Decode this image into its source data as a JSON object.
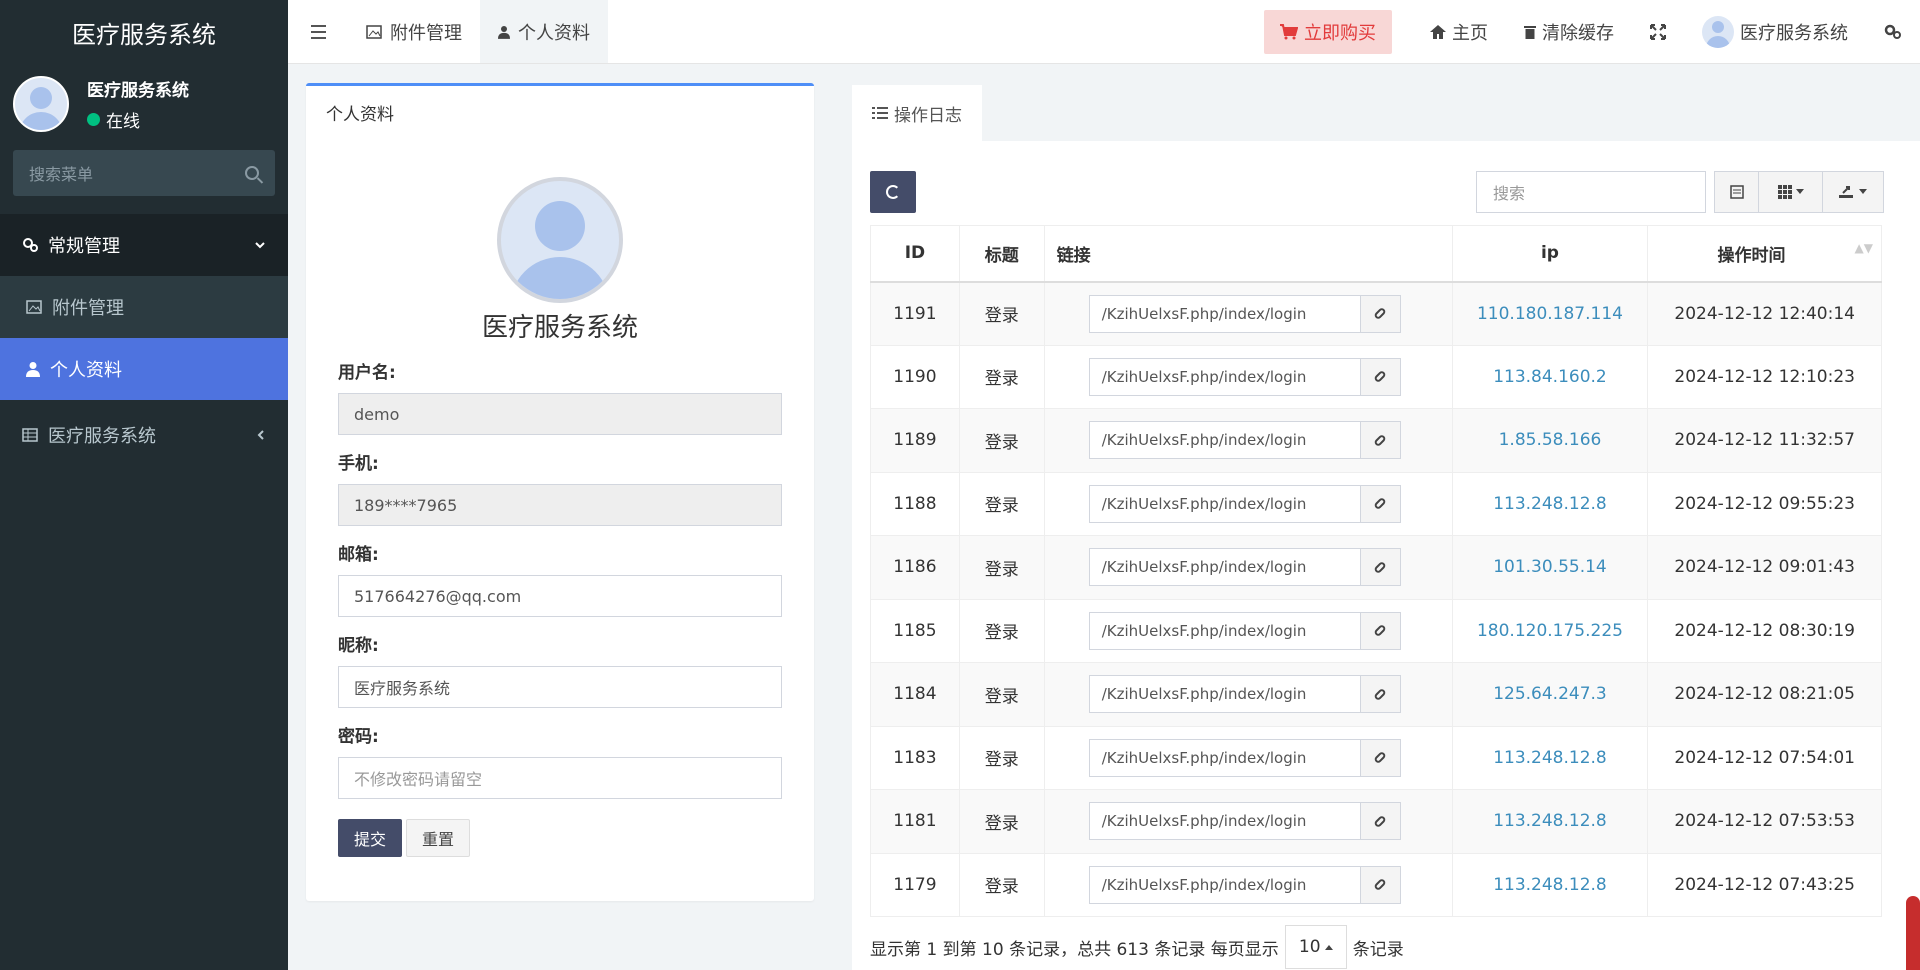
{
  "sidebar": {
    "brand": "医疗服务系统",
    "user": {
      "name": "医疗服务系统",
      "status": "在线"
    },
    "search_placeholder": "搜索菜单",
    "group": {
      "label": "常规管理"
    },
    "items": [
      {
        "label": "附件管理",
        "icon": "image-icon"
      },
      {
        "label": "个人资料",
        "icon": "user-icon",
        "active": true
      }
    ],
    "top_item": {
      "label": "医疗服务系统",
      "icon": "table-icon"
    }
  },
  "topbar": {
    "tabs": [
      {
        "label": "附件管理",
        "icon": "image-icon"
      },
      {
        "label": "个人资料",
        "icon": "user-icon",
        "active": true
      }
    ],
    "buy_label": "立即购买",
    "home_label": "主页",
    "clear_cache_label": "清除缓存",
    "user_label": "医疗服务系统"
  },
  "profile": {
    "card_title": "个人资料",
    "name": "医疗服务系统",
    "fields": {
      "username": {
        "label": "用户名:",
        "value": "demo"
      },
      "mobile": {
        "label": "手机:",
        "value": "189****7965"
      },
      "email": {
        "label": "邮箱:",
        "value": "517664276@qq.com"
      },
      "nickname": {
        "label": "昵称:",
        "value": "医疗服务系统"
      },
      "password": {
        "label": "密码:",
        "placeholder": "不修改密码请留空"
      }
    },
    "submit_label": "提交",
    "reset_label": "重置"
  },
  "log": {
    "tab_label": "操作日志",
    "search_placeholder": "搜索",
    "columns": [
      "ID",
      "标题",
      "链接",
      "ip",
      "操作时间"
    ],
    "rows": [
      {
        "id": "1191",
        "title": "登录",
        "url": "/KzihUelxsF.php/index/login",
        "ip": "110.180.187.114",
        "time": "2024-12-12 12:40:14"
      },
      {
        "id": "1190",
        "title": "登录",
        "url": "/KzihUelxsF.php/index/login",
        "ip": "113.84.160.2",
        "time": "2024-12-12 12:10:23"
      },
      {
        "id": "1189",
        "title": "登录",
        "url": "/KzihUelxsF.php/index/login",
        "ip": "1.85.58.166",
        "time": "2024-12-12 11:32:57"
      },
      {
        "id": "1188",
        "title": "登录",
        "url": "/KzihUelxsF.php/index/login",
        "ip": "113.248.12.8",
        "time": "2024-12-12 09:55:23"
      },
      {
        "id": "1186",
        "title": "登录",
        "url": "/KzihUelxsF.php/index/login",
        "ip": "101.30.55.14",
        "time": "2024-12-12 09:01:43"
      },
      {
        "id": "1185",
        "title": "登录",
        "url": "/KzihUelxsF.php/index/login",
        "ip": "180.120.175.225",
        "time": "2024-12-12 08:30:19"
      },
      {
        "id": "1184",
        "title": "登录",
        "url": "/KzihUelxsF.php/index/login",
        "ip": "125.64.247.3",
        "time": "2024-12-12 08:21:05"
      },
      {
        "id": "1183",
        "title": "登录",
        "url": "/KzihUelxsF.php/index/login",
        "ip": "113.248.12.8",
        "time": "2024-12-12 07:54:01"
      },
      {
        "id": "1181",
        "title": "登录",
        "url": "/KzihUelxsF.php/index/login",
        "ip": "113.248.12.8",
        "time": "2024-12-12 07:53:53"
      },
      {
        "id": "1179",
        "title": "登录",
        "url": "/KzihUelxsF.php/index/login",
        "ip": "113.248.12.8",
        "time": "2024-12-12 07:43:25"
      }
    ],
    "pager": {
      "summary": "显示第 1 到第 10 条记录，总共 613 条记录 每页显示",
      "page_size": "10",
      "suffix": "条记录"
    }
  },
  "colors": {
    "sidebar_bg": "#222d32",
    "accent": "#4e73df",
    "primary_button": "#444c69",
    "buy_text": "#e23b3b",
    "link": "#3c8dbc"
  }
}
